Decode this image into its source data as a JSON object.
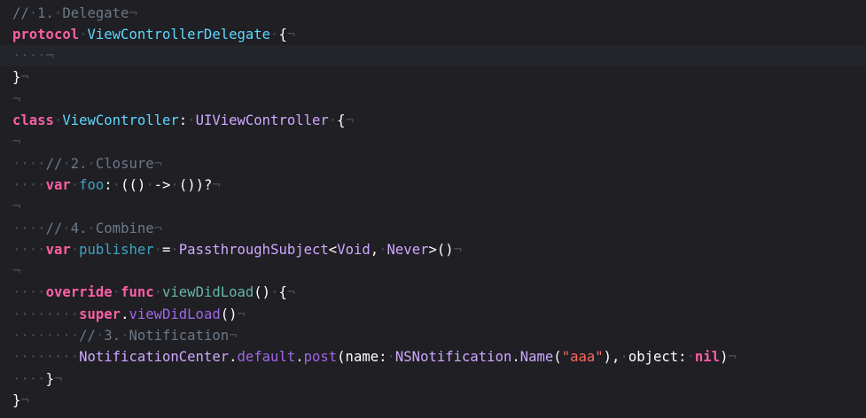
{
  "editor": {
    "colors": {
      "background": "#1f1f24",
      "current_line": "#23252b",
      "invisibles": "#4a4e57",
      "comment": "#6c7986",
      "keyword": "#fc5fa3",
      "type_declaration": "#5dd8ff",
      "type_name": "#d0a8ff",
      "function_declaration": "#67b7a4",
      "method": "#a167e6",
      "property_declaration": "#41a1c0",
      "string": "#fc6a5d",
      "plain": "#ffffff"
    },
    "current_line_index": 2,
    "lines": [
      [
        {
          "c": "comment",
          "t": "//"
        },
        {
          "c": "inv",
          "t": "·"
        },
        {
          "c": "comment",
          "t": "1."
        },
        {
          "c": "inv",
          "t": "·"
        },
        {
          "c": "comment",
          "t": "Delegate"
        },
        {
          "c": "inv",
          "t": "¬"
        }
      ],
      [
        {
          "c": "keyword",
          "t": "protocol"
        },
        {
          "c": "inv",
          "t": "·"
        },
        {
          "c": "type-decl",
          "t": "ViewControllerDelegate"
        },
        {
          "c": "inv",
          "t": "·"
        },
        {
          "c": "plain",
          "t": "{"
        },
        {
          "c": "inv",
          "t": "¬"
        }
      ],
      [
        {
          "c": "inv",
          "t": "····¬"
        }
      ],
      [
        {
          "c": "plain",
          "t": "}"
        },
        {
          "c": "inv",
          "t": "¬"
        }
      ],
      [
        {
          "c": "inv",
          "t": "¬"
        }
      ],
      [
        {
          "c": "keyword",
          "t": "class"
        },
        {
          "c": "inv",
          "t": "·"
        },
        {
          "c": "type-decl",
          "t": "ViewController"
        },
        {
          "c": "plain",
          "t": ":"
        },
        {
          "c": "inv",
          "t": "·"
        },
        {
          "c": "type-name",
          "t": "UIViewController"
        },
        {
          "c": "inv",
          "t": "·"
        },
        {
          "c": "plain",
          "t": "{"
        },
        {
          "c": "inv",
          "t": "¬"
        }
      ],
      [
        {
          "c": "inv",
          "t": "¬"
        }
      ],
      [
        {
          "c": "inv",
          "t": "····"
        },
        {
          "c": "comment",
          "t": "//"
        },
        {
          "c": "inv",
          "t": "·"
        },
        {
          "c": "comment",
          "t": "2."
        },
        {
          "c": "inv",
          "t": "·"
        },
        {
          "c": "comment",
          "t": "Closure"
        },
        {
          "c": "inv",
          "t": "¬"
        }
      ],
      [
        {
          "c": "inv",
          "t": "····"
        },
        {
          "c": "keyword",
          "t": "var"
        },
        {
          "c": "inv",
          "t": "·"
        },
        {
          "c": "prop-decl",
          "t": "foo"
        },
        {
          "c": "plain",
          "t": ":"
        },
        {
          "c": "inv",
          "t": "·"
        },
        {
          "c": "plain",
          "t": "(()"
        },
        {
          "c": "inv",
          "t": "·"
        },
        {
          "c": "plain",
          "t": "->"
        },
        {
          "c": "inv",
          "t": "·"
        },
        {
          "c": "plain",
          "t": "())?"
        },
        {
          "c": "inv",
          "t": "¬"
        }
      ],
      [
        {
          "c": "inv",
          "t": "¬"
        }
      ],
      [
        {
          "c": "inv",
          "t": "····"
        },
        {
          "c": "comment",
          "t": "//"
        },
        {
          "c": "inv",
          "t": "·"
        },
        {
          "c": "comment",
          "t": "4."
        },
        {
          "c": "inv",
          "t": "·"
        },
        {
          "c": "comment",
          "t": "Combine"
        },
        {
          "c": "inv",
          "t": "¬"
        }
      ],
      [
        {
          "c": "inv",
          "t": "····"
        },
        {
          "c": "keyword",
          "t": "var"
        },
        {
          "c": "inv",
          "t": "·"
        },
        {
          "c": "prop-decl",
          "t": "publisher"
        },
        {
          "c": "inv",
          "t": "·"
        },
        {
          "c": "plain",
          "t": "="
        },
        {
          "c": "inv",
          "t": "·"
        },
        {
          "c": "type-name",
          "t": "PassthroughSubject"
        },
        {
          "c": "plain",
          "t": "<"
        },
        {
          "c": "type-name",
          "t": "Void"
        },
        {
          "c": "plain",
          "t": ","
        },
        {
          "c": "inv",
          "t": "·"
        },
        {
          "c": "type-name",
          "t": "Never"
        },
        {
          "c": "plain",
          "t": ">()"
        },
        {
          "c": "inv",
          "t": "¬"
        }
      ],
      [
        {
          "c": "inv",
          "t": "¬"
        }
      ],
      [
        {
          "c": "inv",
          "t": "····"
        },
        {
          "c": "keyword",
          "t": "override"
        },
        {
          "c": "inv",
          "t": "·"
        },
        {
          "c": "keyword",
          "t": "func"
        },
        {
          "c": "inv",
          "t": "·"
        },
        {
          "c": "func-decl",
          "t": "viewDidLoad"
        },
        {
          "c": "plain",
          "t": "()"
        },
        {
          "c": "inv",
          "t": "·"
        },
        {
          "c": "plain",
          "t": "{"
        },
        {
          "c": "inv",
          "t": "¬"
        }
      ],
      [
        {
          "c": "inv",
          "t": "········"
        },
        {
          "c": "keyword",
          "t": "super"
        },
        {
          "c": "plain",
          "t": "."
        },
        {
          "c": "method",
          "t": "viewDidLoad"
        },
        {
          "c": "plain",
          "t": "()"
        },
        {
          "c": "inv",
          "t": "¬"
        }
      ],
      [
        {
          "c": "inv",
          "t": "········"
        },
        {
          "c": "comment",
          "t": "//"
        },
        {
          "c": "inv",
          "t": "·"
        },
        {
          "c": "comment",
          "t": "3."
        },
        {
          "c": "inv",
          "t": "·"
        },
        {
          "c": "comment",
          "t": "Notification"
        },
        {
          "c": "inv",
          "t": "¬"
        }
      ],
      [
        {
          "c": "inv",
          "t": "········"
        },
        {
          "c": "type-name",
          "t": "NotificationCenter"
        },
        {
          "c": "plain",
          "t": "."
        },
        {
          "c": "method",
          "t": "default"
        },
        {
          "c": "plain",
          "t": "."
        },
        {
          "c": "method",
          "t": "post"
        },
        {
          "c": "plain",
          "t": "(name:"
        },
        {
          "c": "inv",
          "t": "·"
        },
        {
          "c": "type-name",
          "t": "NSNotification"
        },
        {
          "c": "plain",
          "t": "."
        },
        {
          "c": "type-name",
          "t": "Name"
        },
        {
          "c": "plain",
          "t": "("
        },
        {
          "c": "string",
          "t": "\"aaa\""
        },
        {
          "c": "plain",
          "t": "),"
        },
        {
          "c": "inv",
          "t": "·"
        },
        {
          "c": "plain",
          "t": "object:"
        },
        {
          "c": "inv",
          "t": "·"
        },
        {
          "c": "keyword",
          "t": "nil"
        },
        {
          "c": "plain",
          "t": ")"
        },
        {
          "c": "inv",
          "t": "¬"
        }
      ],
      [
        {
          "c": "inv",
          "t": "····"
        },
        {
          "c": "plain",
          "t": "}"
        },
        {
          "c": "inv",
          "t": "¬"
        }
      ],
      [
        {
          "c": "plain",
          "t": "}"
        },
        {
          "c": "inv",
          "t": "¬"
        }
      ]
    ]
  }
}
